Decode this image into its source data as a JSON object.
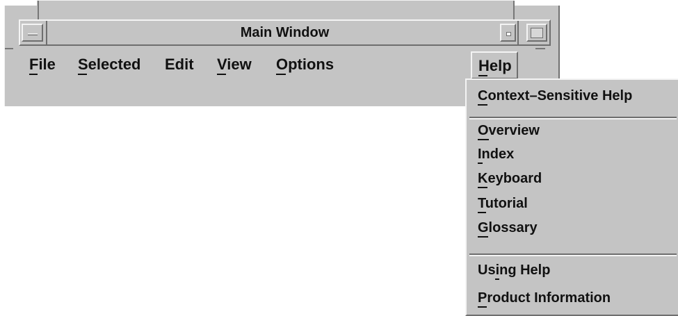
{
  "window": {
    "title": "Main Window",
    "buttons": [
      "minimize-button",
      "restore-button",
      "maximize-button"
    ]
  },
  "menu": {
    "items": [
      {
        "label": "File",
        "underline": "F"
      },
      {
        "label": "Selected",
        "underline": "S"
      },
      {
        "label": "Edit",
        "underline": ""
      },
      {
        "label": "View",
        "underline": "V"
      },
      {
        "label": "Options",
        "underline": "O"
      },
      {
        "label": "Help",
        "underline": "H"
      }
    ]
  },
  "help_menu": {
    "items": [
      {
        "label": "Context–Sensitive Help",
        "mnemonic": "C"
      },
      {
        "label": "Overview",
        "mnemonic": "O"
      },
      {
        "label": "Index",
        "mnemonic": "I"
      },
      {
        "label": "Keyboard",
        "mnemonic": "K"
      },
      {
        "label": "Tutorial",
        "mnemonic": "T"
      },
      {
        "label": "Glossary",
        "mnemonic": "G"
      },
      {
        "label": "Using Help",
        "mnemonic": "i"
      },
      {
        "label": "Product Information",
        "mnemonic": "P"
      }
    ]
  },
  "colors": {
    "chrome": "#c4c4c4",
    "highlight": "#f4f4f4",
    "shadow": "#6e6e6e",
    "text": "#111111"
  }
}
